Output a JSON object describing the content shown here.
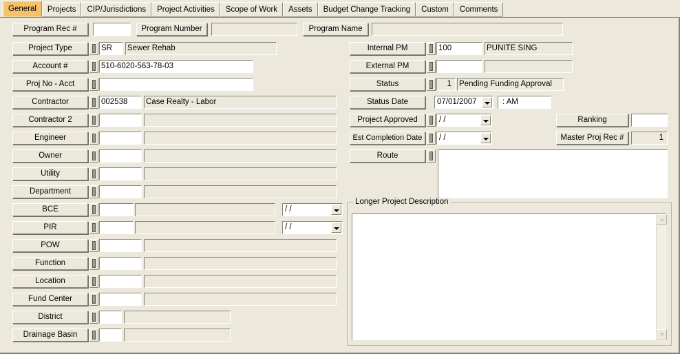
{
  "tabs": [
    {
      "label": "General",
      "active": true
    },
    {
      "label": "Projects",
      "active": false
    },
    {
      "label": "CIP/Jurisdictions",
      "active": false
    },
    {
      "label": "Project Activities",
      "active": false
    },
    {
      "label": "Scope of Work",
      "active": false
    },
    {
      "label": "Assets",
      "active": false
    },
    {
      "label": "Budget Change Tracking",
      "active": false
    },
    {
      "label": "Custom",
      "active": false
    },
    {
      "label": "Comments",
      "active": false
    }
  ],
  "header": {
    "program_rec_label": "Program Rec #",
    "program_rec_value": "",
    "program_number_label": "Program Number",
    "program_number_value": "",
    "program_name_label": "Program Name",
    "program_name_value": ""
  },
  "left_fields": [
    {
      "label": "Project Type",
      "code": "SR",
      "desc": "Sewer Rehab"
    },
    {
      "label": "Account #",
      "code": "510-6020-563-78-03",
      "desc": null
    },
    {
      "label": "Proj No - Acct",
      "code": "",
      "desc": null
    },
    {
      "label": "Contractor",
      "code": "002538",
      "desc": "Case Realty - Labor"
    },
    {
      "label": "Contractor 2",
      "code": "",
      "desc": ""
    },
    {
      "label": "Engineer",
      "code": "",
      "desc": ""
    },
    {
      "label": "Owner",
      "code": "",
      "desc": ""
    },
    {
      "label": "Utility",
      "code": "",
      "desc": ""
    },
    {
      "label": "Department",
      "code": "",
      "desc": ""
    },
    {
      "label": "BCE",
      "code": "",
      "desc": "",
      "date": "/ /"
    },
    {
      "label": "PIR",
      "code": "",
      "desc": "",
      "date": "/ /"
    },
    {
      "label": "POW",
      "code": "",
      "desc": ""
    },
    {
      "label": "Function",
      "code": "",
      "desc": ""
    },
    {
      "label": "Location",
      "code": "",
      "desc": ""
    },
    {
      "label": "Fund Center",
      "code": "",
      "desc": ""
    },
    {
      "label": "District",
      "code": "",
      "desc": "",
      "narrow": true
    },
    {
      "label": "Drainage Basin",
      "code": "",
      "desc": "",
      "narrow": true
    }
  ],
  "right_fields": {
    "internal_pm_label": "Internal PM",
    "internal_pm_code": "100",
    "internal_pm_desc": "PUNITE SING",
    "external_pm_label": "External PM",
    "external_pm_code": "",
    "external_pm_desc": "",
    "status_label": "Status",
    "status_code": "1",
    "status_desc": "Pending Funding Approval",
    "status_date_label": "Status Date",
    "status_date_value": "07/01/2007",
    "status_time_value": ":  AM",
    "project_approved_label": "Project Approved",
    "project_approved_value": "/ /",
    "est_completion_label": "Est Completion Date",
    "est_completion_value": "/ /",
    "route_label": "Route",
    "route_value": "",
    "ranking_label": "Ranking",
    "ranking_value": "",
    "master_proj_label": "Master Proj Rec #",
    "master_proj_value": "1"
  },
  "description_group": {
    "caption": "Longer Project Description",
    "text": ""
  },
  "colors": {
    "window_bg": "#ece9dc",
    "active_tab": "#f5c16a",
    "field_bg": "#ffffff",
    "border_dark": "#85857a"
  }
}
